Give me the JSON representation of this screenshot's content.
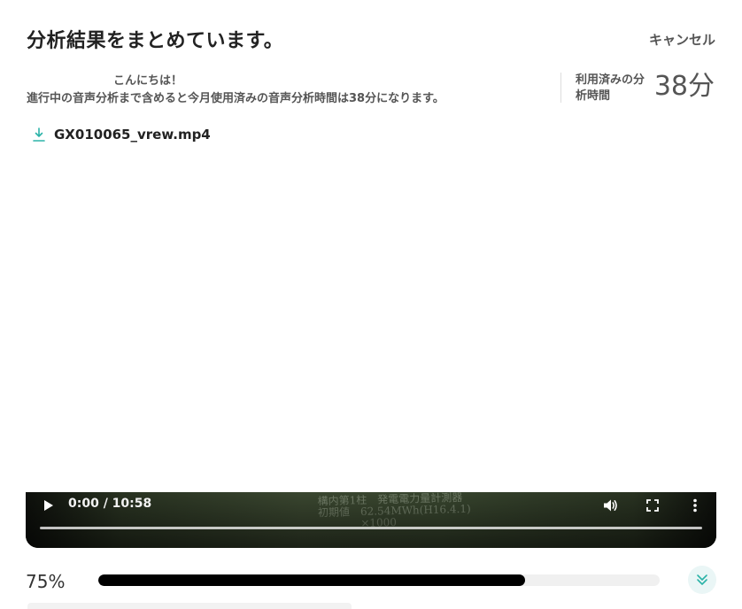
{
  "header": {
    "title": "分析結果をまとめています。",
    "cancel_label": "キャンセル"
  },
  "info": {
    "greeting": "こんにちは！",
    "usage_note": "進行中の音声分析まで含めると今月使用済みの音声分析時間は38分になります。",
    "usage_label": "利用済みの分析時間",
    "usage_value": "38分"
  },
  "file": {
    "icon": "download-icon",
    "name": "GX010065_vrew.mp4"
  },
  "video": {
    "time": "0:00 / 10:58",
    "controls": [
      "play-icon",
      "volume-icon",
      "fullscreen-icon",
      "more-vertical-icon"
    ]
  },
  "progress": {
    "percent_label": "75%",
    "fraction": 0.76,
    "expand_icon": "chevrons-down-icon",
    "accent": "#2bb3a8"
  },
  "colors": {
    "progress_fill": "#000000",
    "track": "#f0f0f0",
    "expand_bg": "#eaf6f6"
  }
}
